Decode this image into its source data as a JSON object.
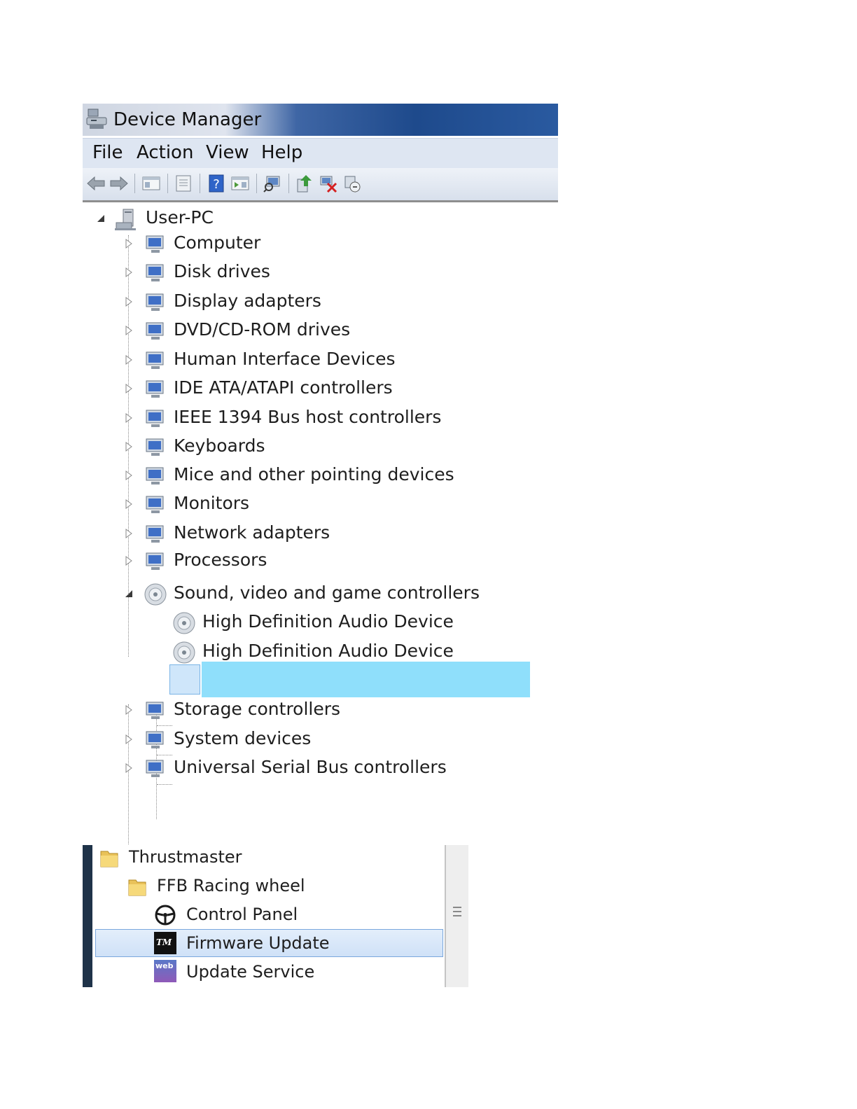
{
  "window": {
    "title": "Device Manager"
  },
  "menu": [
    "File",
    "Action",
    "View",
    "Help"
  ],
  "toolbar": [
    "back-arrow-icon",
    "forward-arrow-icon",
    "show-hide-console-tree-icon",
    "properties-icon",
    "help-icon",
    "action-pane-icon",
    "scan-hardware-icon",
    "update-driver-icon",
    "uninstall-device-icon",
    "disable-device-icon"
  ],
  "tree": {
    "root": "User-PC",
    "categories": [
      "Computer",
      "Disk drives",
      "Display adapters",
      "DVD/CD-ROM drives",
      "Human Interface Devices",
      "IDE ATA/ATAPI controllers",
      "IEEE 1394 Bus host controllers",
      "Keyboards",
      "Mice and other pointing devices",
      "Monitors",
      "Network adapters",
      "Processors",
      "Sound, video and game controllers",
      "Storage controllers",
      "System devices",
      "Universal Serial Bus controllers"
    ],
    "sound_children": [
      "High Definition Audio Device",
      "High Definition Audio Device",
      ""
    ]
  },
  "start_menu": {
    "folder": "Thrustmaster",
    "subfolder": "FFB Racing wheel",
    "items": [
      "Control Panel",
      "Firmware Update",
      "Update Service"
    ],
    "selected": "Firmware Update",
    "firmware_icon_text": "TM",
    "update_icon_text": "web"
  },
  "colors": {
    "highlight": "#8fdffb",
    "titlebar": "#1e4a8c",
    "menubar": "#dee6f2"
  }
}
